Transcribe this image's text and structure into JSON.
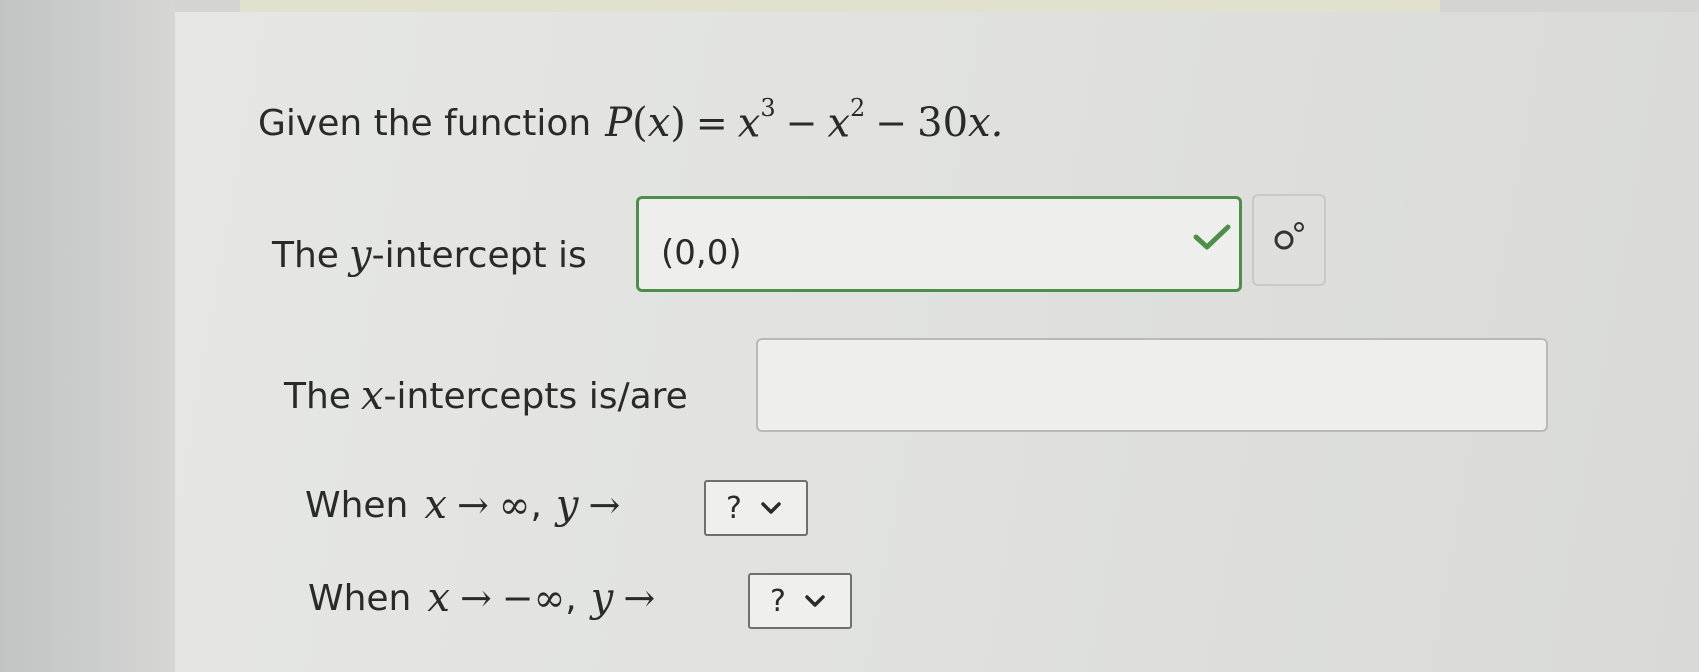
{
  "problem": {
    "prefix": "Given the function",
    "function_name": "P",
    "variable": "x",
    "equals": "=",
    "term1": "x",
    "term1_exp": "3",
    "minus": "−",
    "term2": "x",
    "term2_exp": "2",
    "term3_coef": "30",
    "term3_var": "x",
    "period": "."
  },
  "y_intercept": {
    "label_before": "The",
    "var": "y",
    "label_after": "-intercept is",
    "value": "(0,0)",
    "status": "correct",
    "status_color": "#4d8f4a",
    "status_icon": "checkmark-icon",
    "symbol_button_icon": "special-symbols-icon"
  },
  "x_intercepts": {
    "label_before": "The",
    "var": "x",
    "label_after": "-intercepts is/are",
    "value": ""
  },
  "end_behavior": [
    {
      "prefix": "When",
      "x_var": "x",
      "arrow": "→",
      "x_limit": "∞",
      "comma": ",",
      "y_var": "y",
      "selected": "?"
    },
    {
      "prefix": "When",
      "x_var": "x",
      "arrow": "→",
      "x_limit": "−∞",
      "comma": ",",
      "y_var": "y",
      "selected": "?"
    }
  ]
}
